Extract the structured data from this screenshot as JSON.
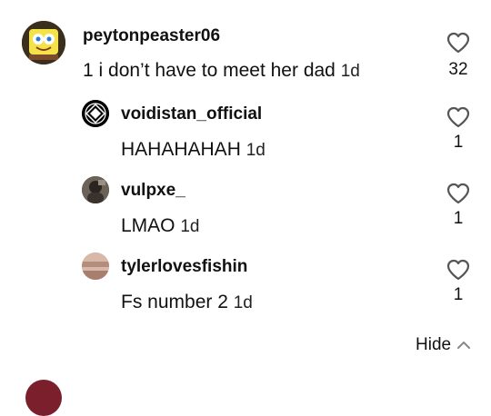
{
  "comments": [
    {
      "username": "peytonpeaster06",
      "text": "1 i don’t have to meet her dad",
      "time": "1d",
      "likes": "32",
      "avatar_icon": "spongebob-avatar"
    },
    {
      "username": "voidistan_official",
      "text": "HAHAHAHAH",
      "time": "1d",
      "likes": "1",
      "avatar_icon": "diamond-logo-avatar"
    },
    {
      "username": "vulpxe_",
      "text": "LMAO",
      "time": "1d",
      "likes": "1",
      "avatar_icon": "photo-avatar"
    },
    {
      "username": "tylerlovesfishin",
      "text": "Fs number 2",
      "time": "1d",
      "likes": "1",
      "avatar_icon": "photo-avatar"
    }
  ],
  "replies_toggle": {
    "label": "Hide",
    "icon": "chevron-up-icon"
  },
  "colors": {
    "text": "#111111",
    "icon_stroke": "#555555",
    "background": "#ffffff"
  }
}
